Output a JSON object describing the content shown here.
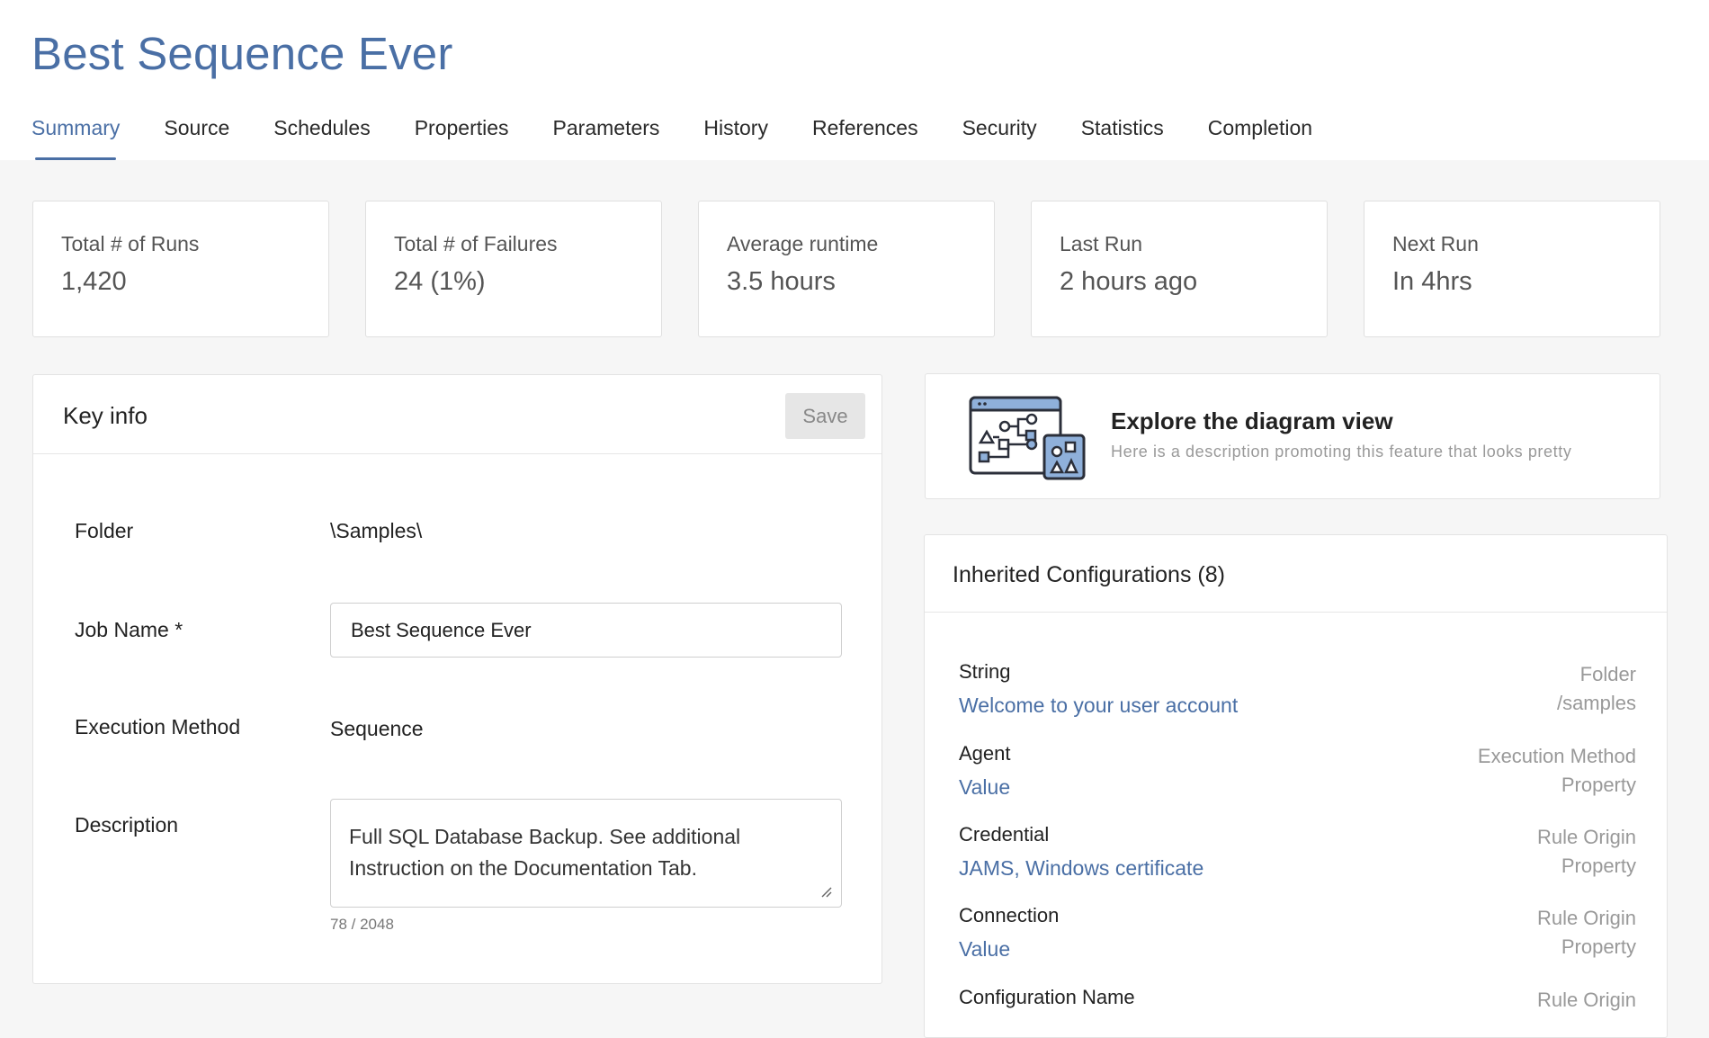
{
  "page": {
    "title": "Best Sequence Ever"
  },
  "tabs": [
    {
      "label": "Summary"
    },
    {
      "label": "Source"
    },
    {
      "label": "Schedules"
    },
    {
      "label": "Properties"
    },
    {
      "label": "Parameters"
    },
    {
      "label": "History"
    },
    {
      "label": "References"
    },
    {
      "label": "Security"
    },
    {
      "label": "Statistics"
    },
    {
      "label": "Completion"
    }
  ],
  "active_tab": "Summary",
  "stats": [
    {
      "label": "Total # of Runs",
      "value": "1,420"
    },
    {
      "label": "Total # of Failures",
      "value": "24 (1%)"
    },
    {
      "label": "Average runtime",
      "value": "3.5 hours"
    },
    {
      "label": "Last Run",
      "value": "2 hours ago"
    },
    {
      "label": "Next Run",
      "value": "In 4hrs"
    }
  ],
  "key_info": {
    "title": "Key info",
    "save_label": "Save",
    "folder_label": "Folder",
    "folder_value": "\\Samples\\",
    "job_name_label": "Job Name *",
    "job_name_value": "Best Sequence Ever",
    "execution_method_label": "Execution Method",
    "execution_method_value": "Sequence",
    "description_label": "Description",
    "description_value": "Full SQL Database Backup. See additional Instruction on the Documentation Tab.",
    "char_count": "78 / 2048"
  },
  "promo": {
    "title": "Explore the diagram view",
    "description": "Here is a description promoting this feature that looks pretty",
    "icon": "diagram-view-icon"
  },
  "inherited": {
    "title": "Inherited Configurations (8)",
    "items": [
      {
        "name": "String",
        "value": "Welcome to your user account",
        "origin_line1": "Folder",
        "origin_line2": "/samples"
      },
      {
        "name": "Agent",
        "value": "Value",
        "origin_line1": "Execution Method",
        "origin_line2": "Property"
      },
      {
        "name": "Credential",
        "value": "JAMS, Windows certificate",
        "origin_line1": "Rule Origin",
        "origin_line2": "Property"
      },
      {
        "name": "Connection",
        "value": "Value",
        "origin_line1": "Rule Origin",
        "origin_line2": "Property"
      },
      {
        "name": "Configuration Name",
        "value": "",
        "origin_line1": "Rule Origin",
        "origin_line2": ""
      }
    ]
  },
  "colors": {
    "accent": "#4a6fa5",
    "background": "#f6f6f6",
    "muted": "#999999"
  }
}
